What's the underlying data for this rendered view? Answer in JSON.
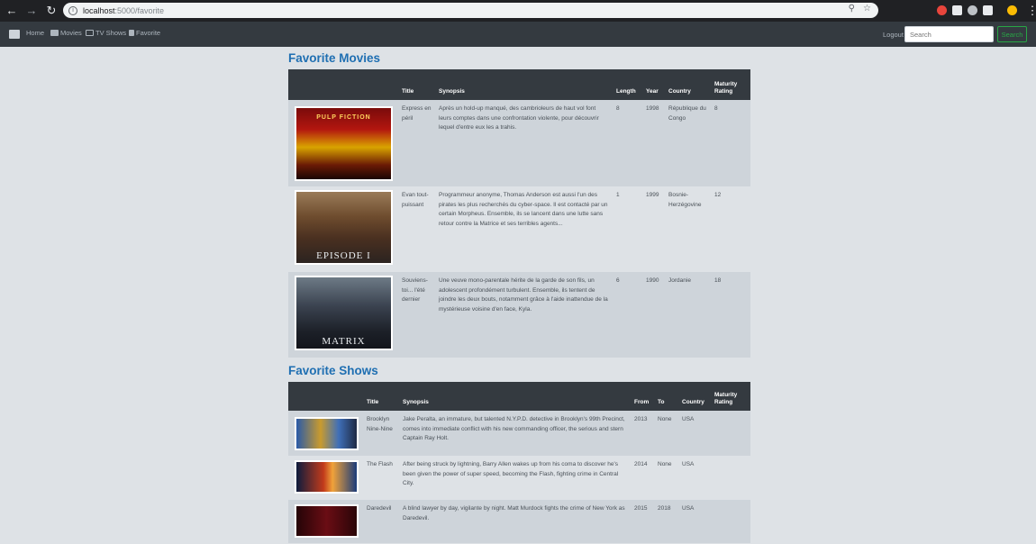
{
  "browser": {
    "url_host": "localhost",
    "url_path": ":5000/favorite",
    "back_icon": "arrow-left-icon",
    "forward_icon": "arrow-right-icon",
    "reload_icon": "reload-icon"
  },
  "nav": {
    "home": "Home",
    "movies": "Movies",
    "tv_shows": "TV Shows",
    "favorite": "Favorite",
    "logout": "Logout",
    "search_placeholder": "Search",
    "search_button": "Search"
  },
  "movies": {
    "heading": "Favorite Movies",
    "columns": {
      "title": "Title",
      "synopsis": "Synopsis",
      "length": "Length",
      "year": "Year",
      "country": "Country",
      "maturity": "Maturity Rating"
    },
    "rows": [
      {
        "title": "Express en péril",
        "synopsis": "Après un hold-up manqué, des cambrioleurs de haut vol font leurs comptes dans une confrontation violente, pour découvrir lequel d'entre eux les a trahis.",
        "length": "8",
        "year": "1998",
        "country": "République du Congo",
        "maturity": "8",
        "poster_caption": "PULP FICTION"
      },
      {
        "title": "Evan tout-puissant",
        "synopsis": "Programmeur anonyme, Thomas Anderson est aussi l'un des pirates les plus recherchés du cyber-space. Il est contacté par un certain Morpheus. Ensemble, ils se lancent dans une lutte sans retour contre la Matrice et ses terribles agents...",
        "length": "1",
        "year": "1999",
        "country": "Bosnie-Herzégovine",
        "maturity": "12",
        "poster_caption": "EPISODE I"
      },
      {
        "title": "Souviens-toi... l'été dernier",
        "synopsis": "Une veuve mono-parentale hérite de la garde de son fils, un adolescent profondément turbulent. Ensemble, ils tentent de joindre les deux bouts, notamment grâce à l'aide inattendue de la mystérieuse voisine d'en face, Kyla.",
        "length": "6",
        "year": "1990",
        "country": "Jordanie",
        "maturity": "18",
        "poster_caption": "MATRIX"
      }
    ]
  },
  "shows": {
    "heading": "Favorite Shows",
    "columns": {
      "title": "Title",
      "synopsis": "Synopsis",
      "from": "From",
      "to": "To",
      "country": "Country",
      "maturity": "Maturity Rating"
    },
    "rows": [
      {
        "title": "Brooklyn Nine-Nine",
        "synopsis": "Jake Peralta, an immature, but talented N.Y.P.D. detective in Brooklyn's 99th Precinct, comes into immediate conflict with his new commanding officer, the serious and stern Captain Ray Holt.",
        "from": "2013",
        "to": "None",
        "country": "USA",
        "maturity": ""
      },
      {
        "title": "The Flash",
        "synopsis": "After being struck by lightning, Barry Allen wakes up from his coma to discover he's been given the power of super speed, becoming the Flash, fighting crime in Central City.",
        "from": "2014",
        "to": "None",
        "country": "USA",
        "maturity": ""
      },
      {
        "title": "Daredevil",
        "synopsis": "A blind lawyer by day, vigilante by night. Matt Murdock fights the crime of New York as Daredevil.",
        "from": "2015",
        "to": "2018",
        "country": "USA",
        "maturity": ""
      }
    ]
  },
  "colors": {
    "page_bg": "#dee2e6",
    "navbar_bg": "#343a40",
    "table_head_bg": "#343a40",
    "heading": "#1f6fb2",
    "search_button": "#28a745"
  }
}
